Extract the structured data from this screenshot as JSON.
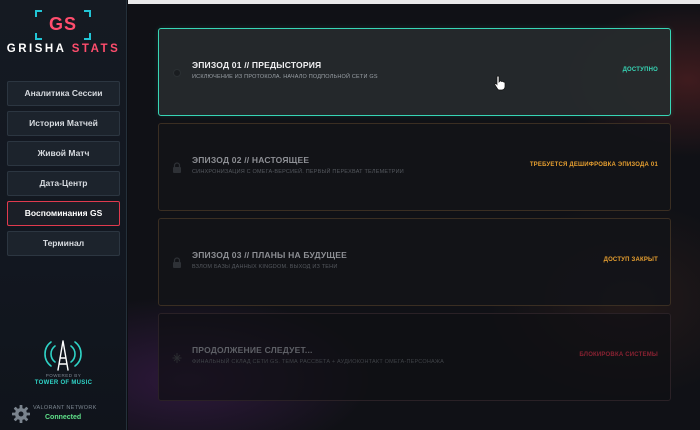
{
  "sidebar": {
    "logo": "GS",
    "brand_part1": "GRISHA ",
    "brand_part2": "STATS",
    "items": [
      {
        "label": "Аналитика Сессии",
        "active": false
      },
      {
        "label": "История Матчей",
        "active": false
      },
      {
        "label": "Живой Матч",
        "active": false
      },
      {
        "label": "Дата-Центр",
        "active": false
      },
      {
        "label": "Воспоминания GS",
        "active": true
      },
      {
        "label": "Терминал",
        "active": false
      }
    ],
    "powered_by": "POWERED BY",
    "tower_name": "TOWER OF MUSIC",
    "network_title": "VALORANT NETWORK",
    "network_status": "Connected"
  },
  "episodes": [
    {
      "title": "ЭПИЗОД 01 // ПРЕДЫСТОРИЯ",
      "subtitle": "ИСКЛЮЧЕНИЕ ИЗ ПРОТОКОЛА. НАЧАЛО ПОДПОЛЬНОЙ СЕТИ GS",
      "status": "ДОСТУПНО",
      "status_color": "#37d6b6",
      "icon": "dot-icon"
    },
    {
      "title": "ЭПИЗОД 02 // НАСТОЯЩЕЕ",
      "subtitle": "СИНХРОНИЗАЦИЯ С ОМЕГА-ВЕРСИЕЙ. ПЕРВЫЙ ПЕРЕХВАТ ТЕЛЕМЕТРИИ",
      "status": "ТРЕБУЕТСЯ ДЕШИФРОВКА ЭПИЗОДА 01",
      "status_color": "#e8a030",
      "icon": "lock-icon"
    },
    {
      "title": "ЭПИЗОД 03 // ПЛАНЫ НА БУДУЩЕЕ",
      "subtitle": "ВЗЛОМ БАЗЫ ДАННЫХ KINGDOM. ВЫХОД ИЗ ТЕНИ",
      "status": "ДОСТУП ЗАКРЫТ",
      "status_color": "#e8a030",
      "icon": "lock-icon"
    },
    {
      "title": "ПРОДОЛЖЕНИЕ СЛЕДУЕТ...",
      "subtitle": "ФИНАЛЬНЫЙ СКЛАД СЕТИ GS. ТЕМА РАССВЕТА + АУДИОКОНТАКТ ОМЕГА-ПЕРСОНАЖА",
      "status": "БЛОКИРОВКА СИСТЕМЫ",
      "status_color": "#8a2232",
      "icon": "star-icon"
    }
  ],
  "colors": {
    "accent_teal": "#37d6b6",
    "accent_red": "#ff4d6d",
    "warning": "#e8a030"
  }
}
